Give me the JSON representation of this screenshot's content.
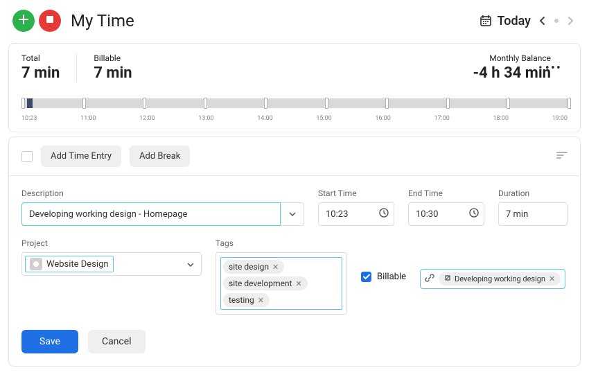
{
  "header": {
    "title": "My Time",
    "today_label": "Today"
  },
  "summary": {
    "total_label": "Total",
    "total_value": "7 min",
    "billable_label": "Billable",
    "billable_value": "7 min",
    "balance_label": "Monthly Balance",
    "balance_value": "-4 h 34 min"
  },
  "timeline": {
    "ticks": [
      "10:23",
      "11:00",
      "12:00",
      "13:00",
      "14:00",
      "15:00",
      "16:00",
      "17:00",
      "18:00",
      "19:00"
    ],
    "entry_pct_left": 1,
    "entry_pct_width": 1.0
  },
  "toolbar": {
    "add_entry": "Add Time Entry",
    "add_break": "Add Break"
  },
  "form": {
    "description_label": "Description",
    "description_value": "Developing working design - Homepage",
    "start_label": "Start Time",
    "start_value": "10:23",
    "end_label": "End Time",
    "end_value": "10:30",
    "duration_label": "Duration",
    "duration_value": "7 min",
    "project_label": "Project",
    "project_value": "Website Design",
    "tags_label": "Tags",
    "tags": [
      "site design",
      "site development",
      "testing"
    ],
    "billable_label": "Billable",
    "linked_task": "Developing working design",
    "save_label": "Save",
    "cancel_label": "Cancel"
  }
}
